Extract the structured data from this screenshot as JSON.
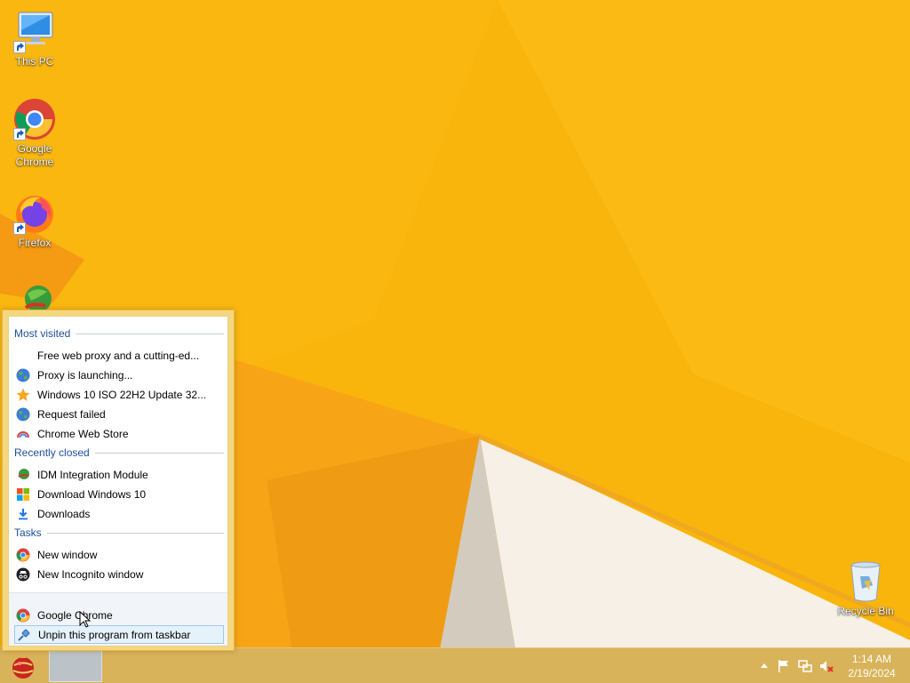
{
  "desktop": {
    "icons": [
      {
        "label": "This PC"
      },
      {
        "label": "Google Chrome"
      },
      {
        "label": "Firefox"
      },
      {
        "label": "Recycle Bin"
      }
    ]
  },
  "jumplist": {
    "most_visited": {
      "header": "Most visited",
      "items": [
        {
          "label": "Free web proxy and a cutting-ed...",
          "icon": "blank-page-icon"
        },
        {
          "label": "Proxy is launching...",
          "icon": "globe-icon"
        },
        {
          "label": "Windows 10 ISO 22H2 Update 32...",
          "icon": "star-icon"
        },
        {
          "label": "Request failed",
          "icon": "globe-icon"
        },
        {
          "label": "Chrome Web Store",
          "icon": "chrome-web-store-icon"
        }
      ]
    },
    "recently_closed": {
      "header": "Recently closed",
      "items": [
        {
          "label": "IDM Integration Module",
          "icon": "idm-icon"
        },
        {
          "label": "Download Windows 10",
          "icon": "windows-logo-icon"
        },
        {
          "label": "Downloads",
          "icon": "download-arrow-icon"
        }
      ]
    },
    "tasks": {
      "header": "Tasks",
      "items": [
        {
          "label": "New window",
          "icon": "chrome-icon"
        },
        {
          "label": "New Incognito window",
          "icon": "incognito-icon"
        }
      ]
    },
    "footer": {
      "app_label": "Google Chrome",
      "unpin_label": "Unpin this program from taskbar"
    }
  },
  "taskbar": {
    "clock": {
      "time": "1:14 AM",
      "date": "2/19/2024"
    }
  }
}
